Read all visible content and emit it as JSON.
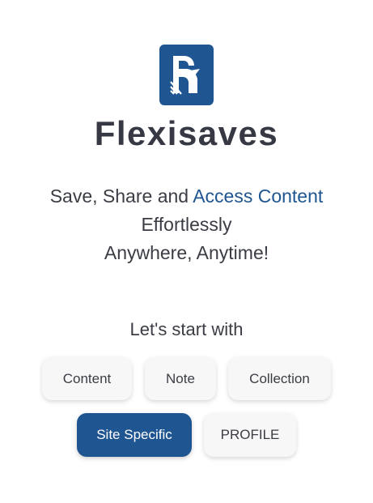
{
  "brand": {
    "name": "Flexisaves",
    "logo_icon": "flexisaves-logo-icon",
    "primary_color": "#1f5591"
  },
  "tagline": {
    "line1_prefix": "Save, Share and ",
    "line1_accent": "Access Content",
    "line2": "Effortlessly",
    "line3": "Anywhere, Anytime!"
  },
  "start": {
    "heading": "Let's start with",
    "buttons": [
      {
        "label": "Content"
      },
      {
        "label": "Note"
      },
      {
        "label": "Collection"
      },
      {
        "label": "Site Specific",
        "selected": true
      },
      {
        "label": "PROFILE"
      }
    ]
  }
}
